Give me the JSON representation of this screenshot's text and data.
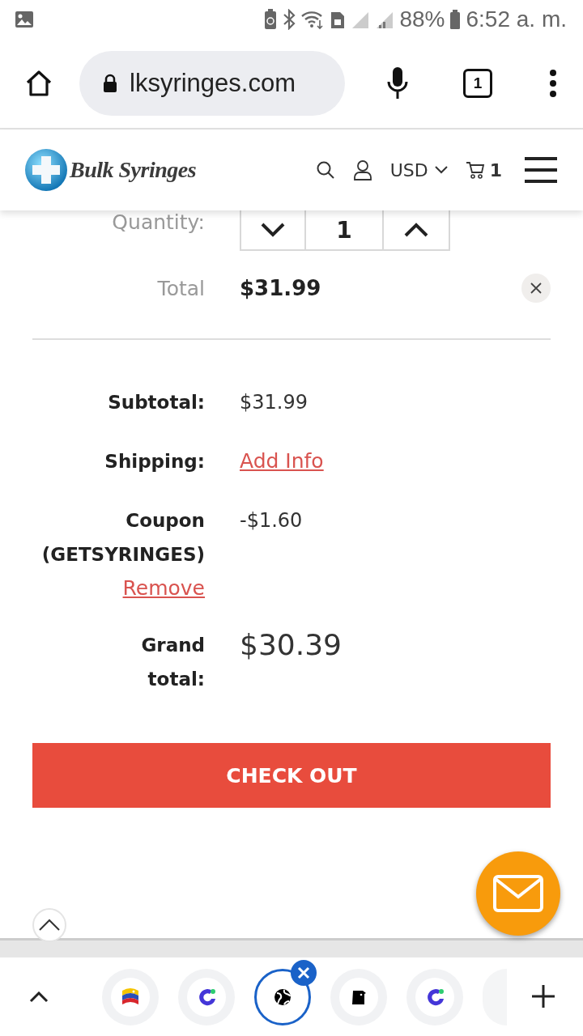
{
  "status_bar": {
    "battery": "88%",
    "time": "6:52 a. m."
  },
  "browser": {
    "url": "lksyringes.com",
    "tab_count": "1"
  },
  "site_header": {
    "brand": "Bulk Syringes",
    "currency": "USD",
    "cart_count": "1"
  },
  "item": {
    "quantity_label": "Quantity:",
    "quantity": "1",
    "total_label": "Total",
    "total": "$31.99"
  },
  "summary": [
    {
      "kind": "text",
      "label": "Subtotal:",
      "value": "$31.99"
    },
    {
      "kind": "link",
      "label": "Shipping:",
      "value": "Add Info"
    },
    {
      "kind": "coupon",
      "label": "Coupon (GETSYRINGES)",
      "value": "-$1.60",
      "action": "Remove"
    },
    {
      "kind": "grand",
      "label": "Grand total:",
      "value": "$30.39"
    }
  ],
  "checkout_button": "CHECK OUT",
  "tab_strip": {
    "tabs": [
      {
        "kind": "flag",
        "selected": false
      },
      {
        "kind": "ring",
        "selected": false
      },
      {
        "kind": "globe",
        "selected": true
      },
      {
        "kind": "jar",
        "selected": false
      },
      {
        "kind": "ring",
        "selected": false
      },
      {
        "kind": "blank",
        "selected": false
      }
    ]
  }
}
